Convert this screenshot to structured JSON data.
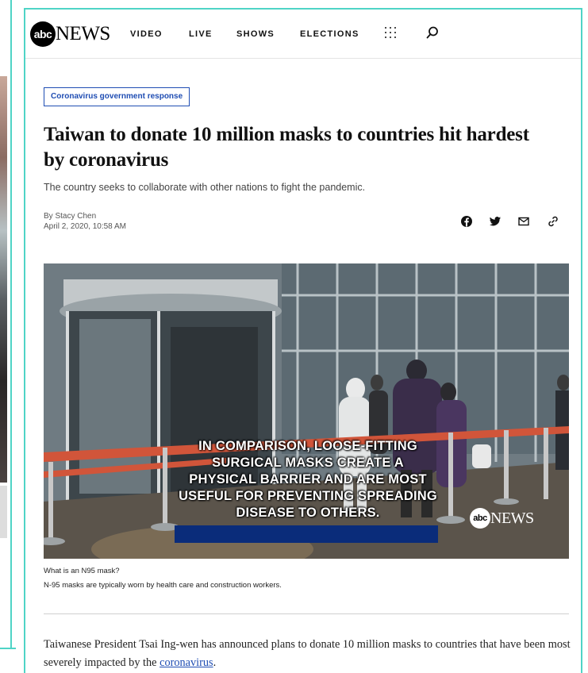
{
  "nav": {
    "logo_disc": "abc",
    "logo_news": "NEWS",
    "links": [
      "VIDEO",
      "LIVE",
      "SHOWS",
      "ELECTIONS"
    ]
  },
  "article": {
    "tag": "Coronavirus government response",
    "headline": "Taiwan to donate 10 million masks to countries hit hardest by coronavirus",
    "subhead": "The country seeks to collaborate with other nations to fight the pandemic.",
    "author": "By Stacy Chen",
    "date": "April 2, 2020, 10:58 AM",
    "share_icons": [
      "facebook-icon",
      "twitter-icon",
      "email-icon",
      "link-icon"
    ]
  },
  "video": {
    "caption_text": "IN COMPARISON, LOOSE-FITTING SURGICAL MASKS CREATE A PHYSICAL BARRIER AND ARE MOST USEFUL FOR PREVENTING SPREADING DISEASE TO OTHERS.",
    "logo_disc": "abc",
    "logo_news": "NEWS",
    "title": "What is an N95 mask?",
    "description": "N-95 masks are typically worn by health care and construction workers."
  },
  "body": {
    "text_before_link": "Taiwanese President Tsai Ing-wen has announced plans to donate 10 million masks to countries that have been most severely impacted by the ",
    "link_text": "coronavirus",
    "text_after_link": "."
  },
  "colors": {
    "accent_teal": "#4fd4c6",
    "tag_blue": "#1f4db3",
    "caption_bar": "#0a2c7a"
  }
}
